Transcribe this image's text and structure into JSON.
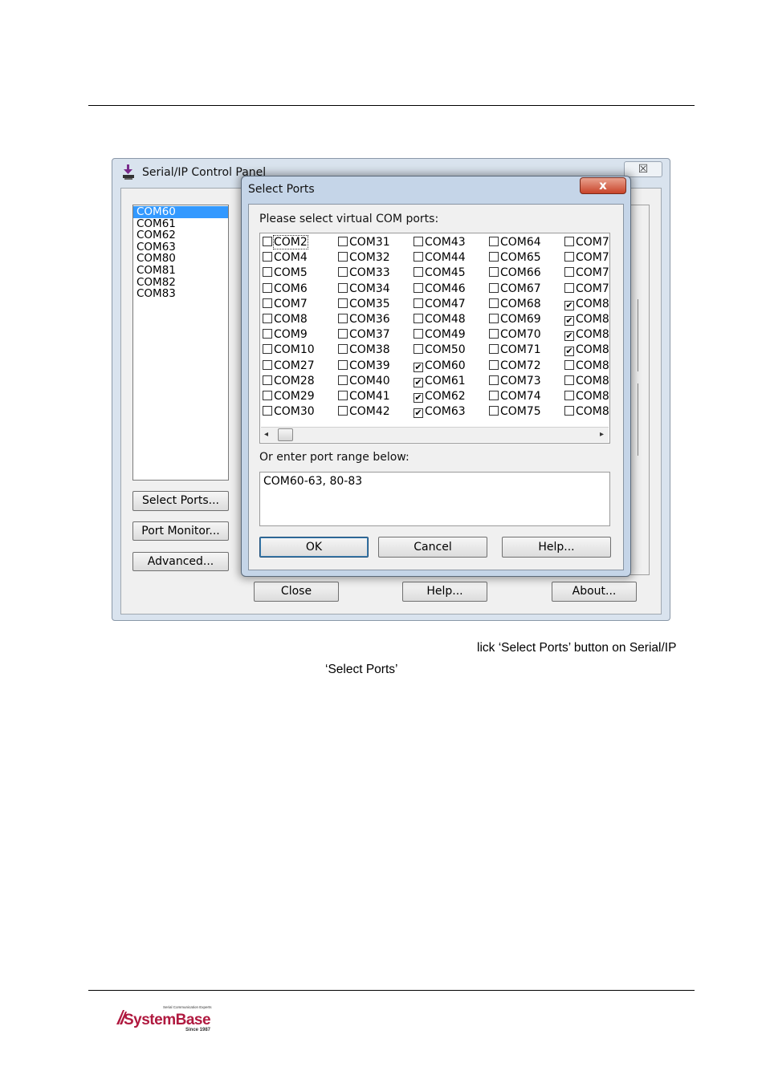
{
  "outer_window": {
    "title": "Serial/IP Control Panel",
    "close_glyph": "☒",
    "port_list": [
      "COM60",
      "COM61",
      "COM62",
      "COM63",
      "COM80",
      "COM81",
      "COM82",
      "COM83"
    ],
    "selected_port": "COM60",
    "buttons": {
      "select_ports": "Select Ports...",
      "port_monitor": "Port Monitor...",
      "advanced": "Advanced...",
      "close": "Close",
      "help": "Help...",
      "about": "About..."
    }
  },
  "dialog": {
    "title": "Select Ports",
    "close_glyph": "x",
    "prompt": "Please select virtual COM ports:",
    "columns": [
      [
        {
          "label": "COM2",
          "checked": false,
          "focused": true
        },
        {
          "label": "COM4",
          "checked": false
        },
        {
          "label": "COM5",
          "checked": false
        },
        {
          "label": "COM6",
          "checked": false
        },
        {
          "label": "COM7",
          "checked": false
        },
        {
          "label": "COM8",
          "checked": false
        },
        {
          "label": "COM9",
          "checked": false
        },
        {
          "label": "COM10",
          "checked": false
        },
        {
          "label": "COM27",
          "checked": false
        },
        {
          "label": "COM28",
          "checked": false
        },
        {
          "label": "COM29",
          "checked": false
        },
        {
          "label": "COM30",
          "checked": false
        }
      ],
      [
        {
          "label": "COM31",
          "checked": false
        },
        {
          "label": "COM32",
          "checked": false
        },
        {
          "label": "COM33",
          "checked": false
        },
        {
          "label": "COM34",
          "checked": false
        },
        {
          "label": "COM35",
          "checked": false
        },
        {
          "label": "COM36",
          "checked": false
        },
        {
          "label": "COM37",
          "checked": false
        },
        {
          "label": "COM38",
          "checked": false
        },
        {
          "label": "COM39",
          "checked": false
        },
        {
          "label": "COM40",
          "checked": false
        },
        {
          "label": "COM41",
          "checked": false
        },
        {
          "label": "COM42",
          "checked": false
        }
      ],
      [
        {
          "label": "COM43",
          "checked": false
        },
        {
          "label": "COM44",
          "checked": false
        },
        {
          "label": "COM45",
          "checked": false
        },
        {
          "label": "COM46",
          "checked": false
        },
        {
          "label": "COM47",
          "checked": false
        },
        {
          "label": "COM48",
          "checked": false
        },
        {
          "label": "COM49",
          "checked": false
        },
        {
          "label": "COM50",
          "checked": false
        },
        {
          "label": "COM60",
          "checked": true
        },
        {
          "label": "COM61",
          "checked": true
        },
        {
          "label": "COM62",
          "checked": true
        },
        {
          "label": "COM63",
          "checked": true
        }
      ],
      [
        {
          "label": "COM64",
          "checked": false
        },
        {
          "label": "COM65",
          "checked": false
        },
        {
          "label": "COM66",
          "checked": false
        },
        {
          "label": "COM67",
          "checked": false
        },
        {
          "label": "COM68",
          "checked": false
        },
        {
          "label": "COM69",
          "checked": false
        },
        {
          "label": "COM70",
          "checked": false
        },
        {
          "label": "COM71",
          "checked": false
        },
        {
          "label": "COM72",
          "checked": false
        },
        {
          "label": "COM73",
          "checked": false
        },
        {
          "label": "COM74",
          "checked": false
        },
        {
          "label": "COM75",
          "checked": false
        }
      ],
      [
        {
          "label": "COM7",
          "checked": false
        },
        {
          "label": "COM7",
          "checked": false
        },
        {
          "label": "COM7",
          "checked": false
        },
        {
          "label": "COM7",
          "checked": false
        },
        {
          "label": "COM8",
          "checked": true
        },
        {
          "label": "COM8",
          "checked": true
        },
        {
          "label": "COM8",
          "checked": true
        },
        {
          "label": "COM8",
          "checked": true
        },
        {
          "label": "COM8",
          "checked": false
        },
        {
          "label": "COM8",
          "checked": false
        },
        {
          "label": "COM8",
          "checked": false
        },
        {
          "label": "COM8",
          "checked": false
        }
      ]
    ],
    "range_label": "Or enter port range below:",
    "range_value": "COM60-63, 80-83",
    "scroll_left": "◂",
    "scroll_right": "▸",
    "buttons": {
      "ok": "OK",
      "cancel": "Cancel",
      "help": "Help..."
    }
  },
  "caption": {
    "line1": "lick ‘Select Ports’ button on Serial/IP",
    "line2": "‘Select Ports’"
  },
  "logo": {
    "tagline": "Serial Communication Experts",
    "name": "SystemBase",
    "since": "Since 1987",
    "color": "#b0193f"
  }
}
